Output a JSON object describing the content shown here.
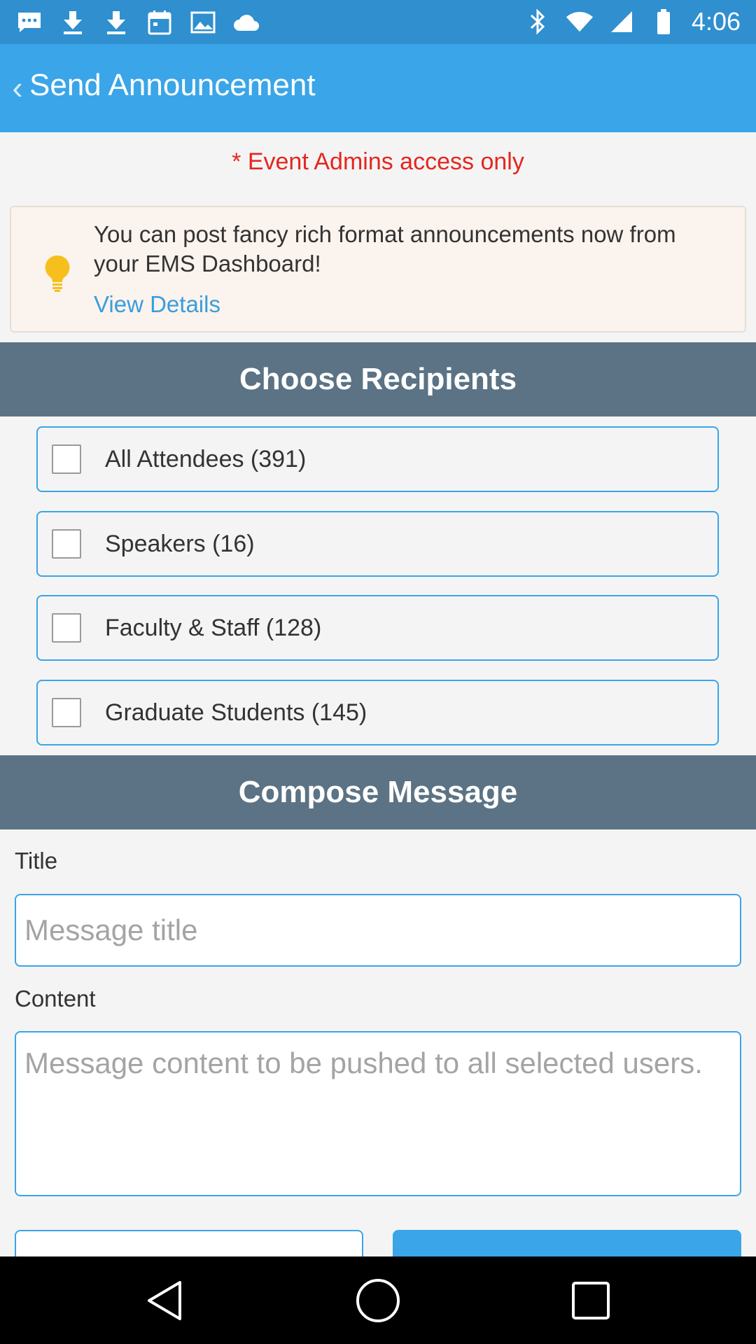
{
  "status_bar": {
    "time": "4:06",
    "left_icons": [
      "message-icon",
      "download-icon",
      "download-icon",
      "calendar-icon",
      "photo-icon",
      "cloud-icon"
    ],
    "right_icons": [
      "bluetooth-icon",
      "wifi-icon",
      "signal-icon",
      "battery-icon"
    ]
  },
  "header": {
    "back_icon": "‹",
    "title": "Send Announcement"
  },
  "admin_note": "* Event Admins access only",
  "tip": {
    "icon": "lightbulb-icon",
    "text": "You can post fancy rich format announcements now from your EMS Dashboard!",
    "link": "View Details"
  },
  "recipients_section": {
    "title": "Choose Recipients",
    "items": [
      {
        "label": "All Attendees (391)",
        "checked": false
      },
      {
        "label": "Speakers (16)",
        "checked": false
      },
      {
        "label": "Faculty & Staff (128)",
        "checked": false
      },
      {
        "label": "Graduate Students (145)",
        "checked": false
      }
    ]
  },
  "compose_section": {
    "title": "Compose Message",
    "title_label": "Title",
    "title_placeholder": "Message title",
    "content_label": "Content",
    "content_placeholder": "Message content to be pushed to all selected users."
  },
  "colors": {
    "status_bar": "#2f8fcf",
    "app_bar": "#3aa5e8",
    "section_header": "#5b7384",
    "admin_note": "#e5261f",
    "link": "#3a9ddb"
  },
  "nav_bar": {
    "buttons": [
      "back-nav-icon",
      "home-nav-icon",
      "recents-nav-icon"
    ]
  }
}
